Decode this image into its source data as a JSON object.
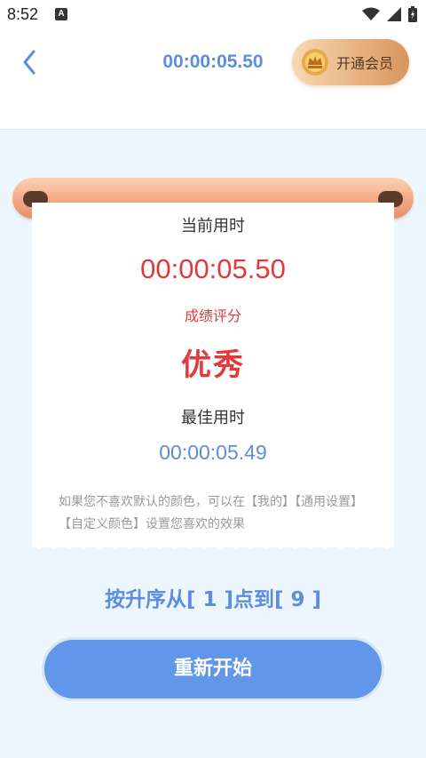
{
  "status_bar": {
    "time": "8:52",
    "notification_letter": "A"
  },
  "header": {
    "timer": "00:00:05.50",
    "vip_label": "开通会员"
  },
  "result": {
    "current_label": "当前用时",
    "current_time": "00:00:05.50",
    "score_label": "成绩评分",
    "score_value": "优秀",
    "best_label": "最佳用时",
    "best_time": "00:00:05.49",
    "hint": "如果您不喜欢默认的颜色，可以在【我的】【通用设置】【自定义颜色】设置您喜欢的效果"
  },
  "instruction": "按升序从[ 1 ]点到[ 9 ]",
  "restart_label": "重新开始",
  "colors": {
    "accent": "#5b8ee0",
    "button": "#6196e9",
    "score": "#e23a3a",
    "gold": "#e9b786"
  },
  "icons": [
    "wifi-icon",
    "cellular-signal-icon",
    "battery-icon",
    "back-arrow-icon",
    "vip-crown-icon"
  ]
}
